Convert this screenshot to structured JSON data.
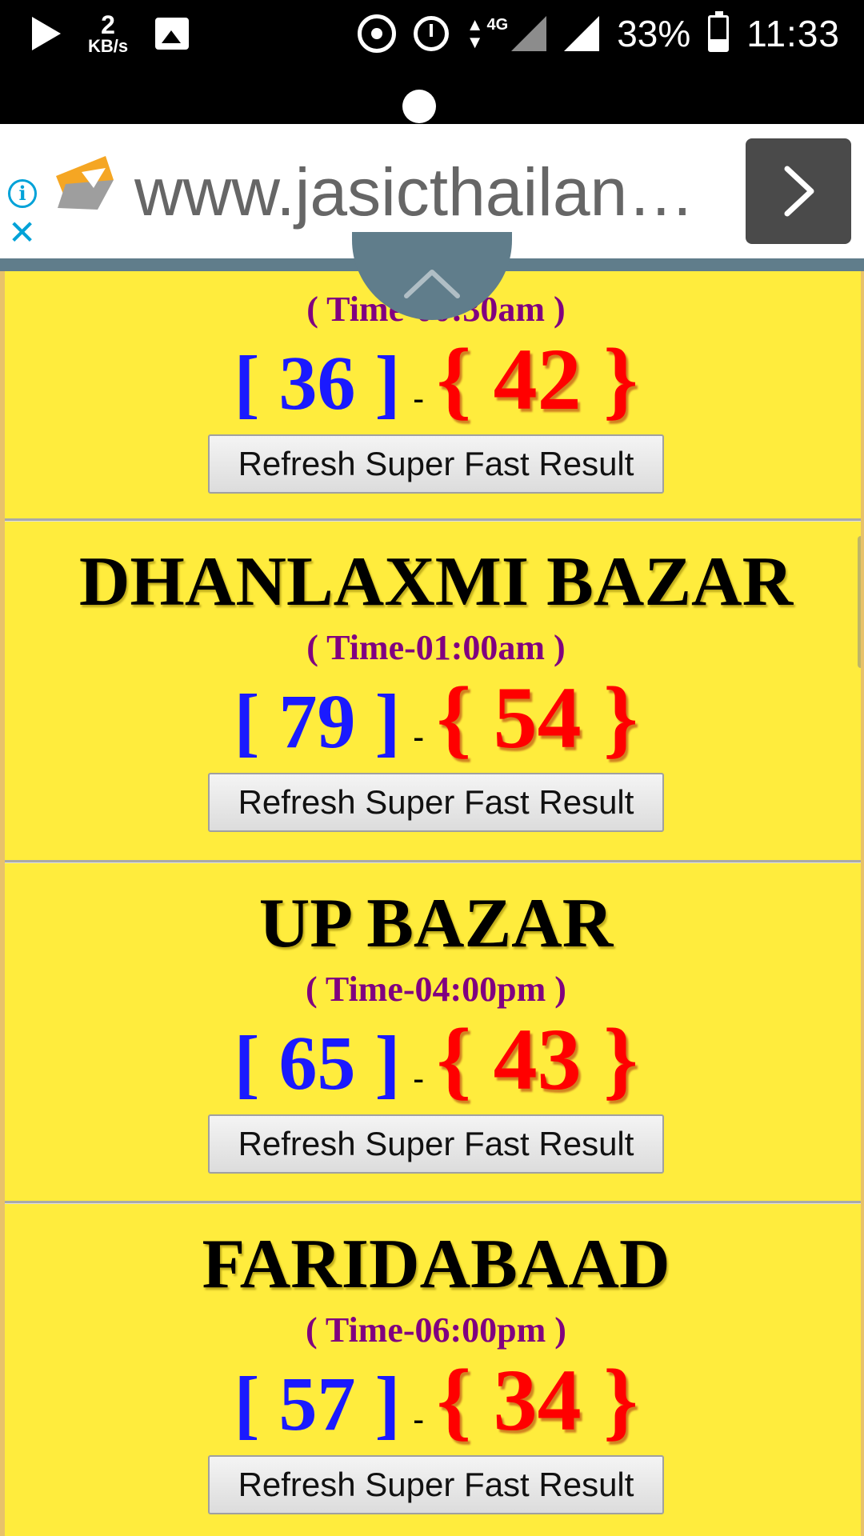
{
  "status_bar": {
    "speed_value": "2",
    "speed_unit": "KB/s",
    "network": "4G",
    "battery": "33%",
    "time": "11:33"
  },
  "ad": {
    "url": "www.jasicthailan…",
    "info_icon": "i",
    "close_icon": "✕"
  },
  "cards": [
    {
      "name": "",
      "time": "( Time-00:30am )",
      "open": "[ 36 ]",
      "dash": "-",
      "jodi": "{ 42 }",
      "button": "Refresh Super Fast Result"
    },
    {
      "name": "DHANLAXMI BAZAR",
      "time": "( Time-01:00am )",
      "open": "[ 79 ]",
      "dash": "-",
      "jodi": "{ 54 }",
      "button": "Refresh Super Fast Result"
    },
    {
      "name": "UP BAZAR",
      "time": "( Time-04:00pm )",
      "open": "[ 65 ]",
      "dash": "-",
      "jodi": "{ 43 }",
      "button": "Refresh Super Fast Result"
    },
    {
      "name": "FARIDABAAD",
      "time": "( Time-06:00pm )",
      "open": "[ 57 ]",
      "dash": "-",
      "jodi": "{ 34 }",
      "button": "Refresh Super Fast Result"
    }
  ],
  "colors": {
    "background": "#ffec3d",
    "open_number": "#1a1aff",
    "jodi_number": "#ff0000",
    "time_text": "#800080",
    "ad_accent": "#00a2d8"
  }
}
